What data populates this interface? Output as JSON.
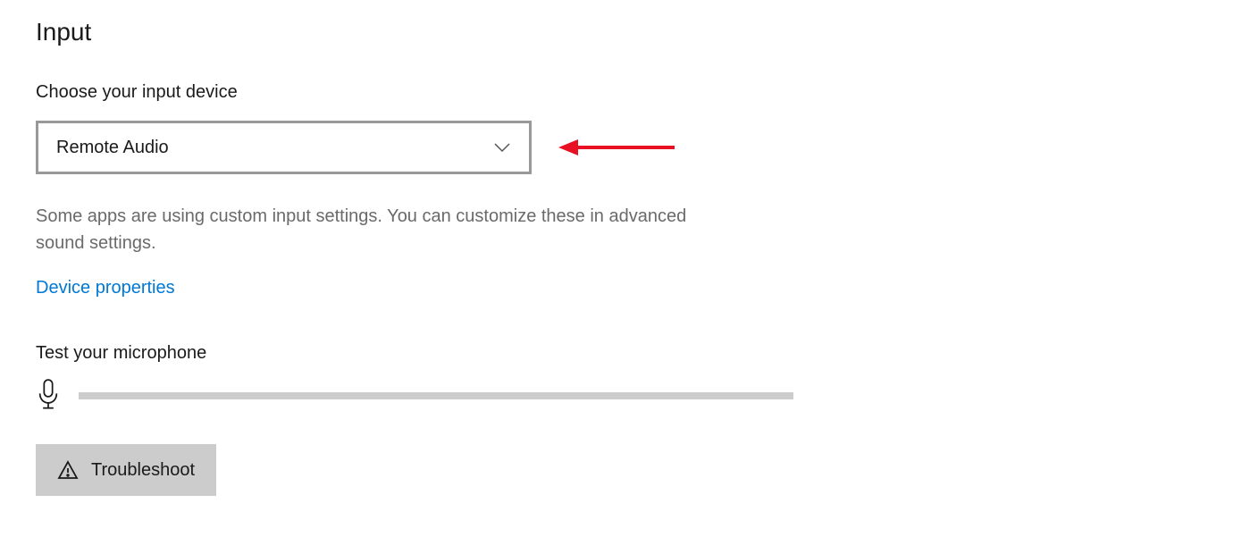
{
  "section": {
    "title": "Input"
  },
  "input_device": {
    "label": "Choose your input device",
    "selected": "Remote Audio",
    "description": "Some apps are using custom input settings. You can customize these in advanced sound settings."
  },
  "links": {
    "device_properties": "Device properties"
  },
  "mic_test": {
    "label": "Test your microphone"
  },
  "troubleshoot": {
    "label": "Troubleshoot"
  }
}
